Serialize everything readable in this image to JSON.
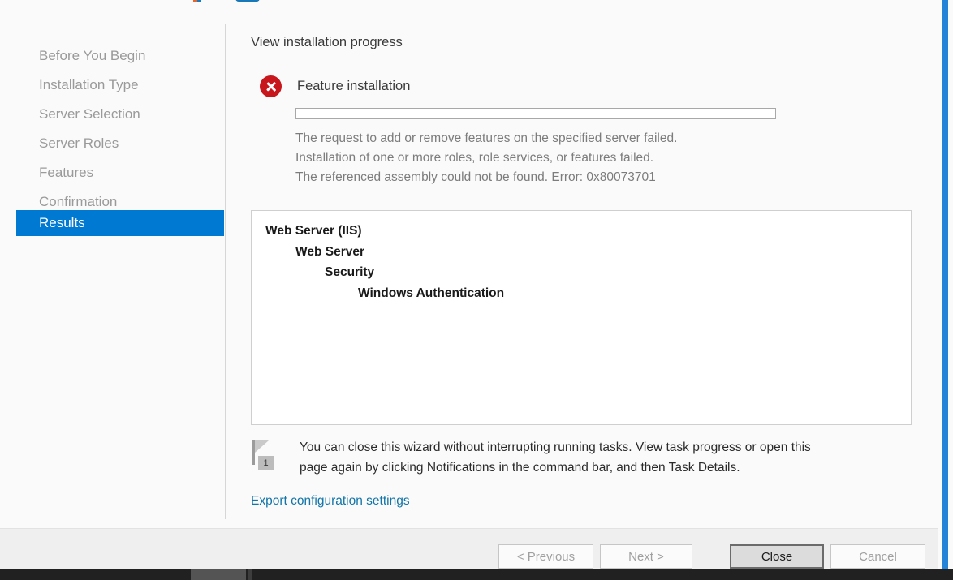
{
  "window": {
    "accent_color": "#2484d8",
    "background_color": "#fafafa"
  },
  "sidebar": {
    "items": [
      {
        "label": "Before You Begin",
        "selected": false
      },
      {
        "label": "Installation Type",
        "selected": false
      },
      {
        "label": "Server Selection",
        "selected": false
      },
      {
        "label": "Server Roles",
        "selected": false
      },
      {
        "label": "Features",
        "selected": false
      },
      {
        "label": "Confirmation",
        "selected": false
      },
      {
        "label": "Results",
        "selected": true
      }
    ],
    "selected_color": "#0079d3",
    "disabled_text_color": "#9a9a9a"
  },
  "content": {
    "page_title": "View installation progress",
    "status": {
      "icon": "error-icon",
      "icon_color": "#c8161d",
      "label": "Feature installation"
    },
    "progress": {
      "percent": 0
    },
    "error_messages": [
      "The request to add or remove features on the specified server failed.",
      "Installation of one or more roles, role services, or features failed.",
      "The referenced assembly could not be found. Error: 0x80073701"
    ],
    "feature_tree": [
      {
        "label": "Web Server (IIS)",
        "level": 0
      },
      {
        "label": "Web Server",
        "level": 1
      },
      {
        "label": "Security",
        "level": 2
      },
      {
        "label": "Windows Authentication",
        "level": 3
      }
    ],
    "note": {
      "icon": "notification-flag-icon",
      "badge_count": "1",
      "lines": [
        "You can close this wizard without interrupting running tasks. View task progress or open this",
        "page again by clicking Notifications in the command bar, and then Task Details."
      ]
    },
    "export_link": "Export configuration settings",
    "link_color": "#1274a8"
  },
  "footer": {
    "buttons": [
      {
        "label": "< Previous",
        "state": "disabled"
      },
      {
        "label": "Next >",
        "state": "disabled"
      },
      {
        "label": "Close",
        "state": "focused"
      },
      {
        "label": "Cancel",
        "state": "disabled"
      }
    ]
  }
}
